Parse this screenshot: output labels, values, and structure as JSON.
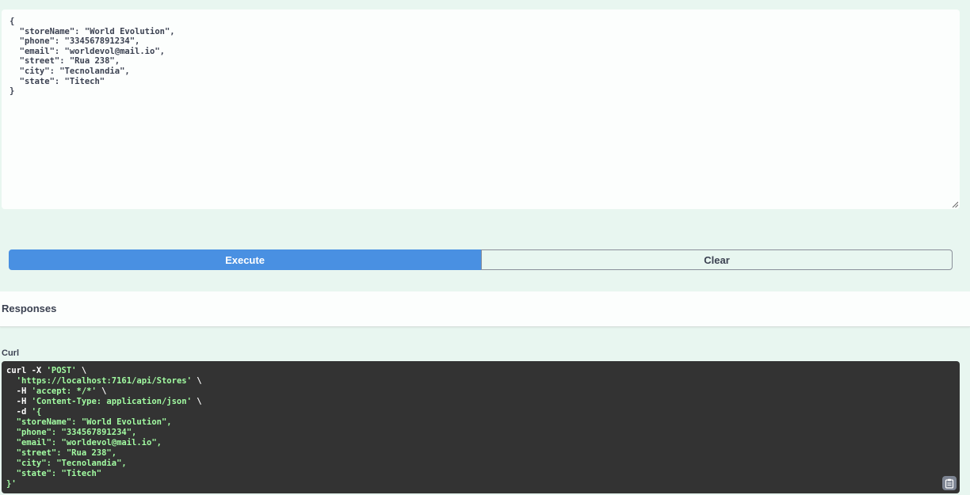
{
  "request_body": {
    "lines": [
      "{",
      "  \"storeName\": \"World Evolution\",",
      "  \"phone\": \"334567891234\",",
      "  \"email\": \"worldevol@mail.io\",",
      "  \"street\": \"Rua 238\",",
      "  \"city\": \"Tecnolandia\",",
      "  \"state\": \"Titech\"",
      "}"
    ]
  },
  "actions": {
    "execute_label": "Execute",
    "clear_label": "Clear"
  },
  "responses": {
    "title": "Responses",
    "curl_label": "Curl",
    "curl_lines": [
      [
        "curl -X ",
        "'POST'",
        " \\"
      ],
      [
        "  ",
        "'https://localhost:7161/api/Stores'",
        " \\"
      ],
      [
        "  -H ",
        "'accept: */*'",
        " \\"
      ],
      [
        "  -H ",
        "'Content-Type: application/json'",
        " \\"
      ],
      [
        "  -d ",
        "'{",
        ""
      ],
      [
        "",
        "  \"storeName\": \"World Evolution\",",
        ""
      ],
      [
        "",
        "  \"phone\": \"334567891234\",",
        ""
      ],
      [
        "",
        "  \"email\": \"worldevol@mail.io\",",
        ""
      ],
      [
        "",
        "  \"street\": \"Rua 238\",",
        ""
      ],
      [
        "",
        "  \"city\": \"Tecnolandia\",",
        ""
      ],
      [
        "",
        "  \"state\": \"Titech\"",
        ""
      ],
      [
        "",
        "}'",
        ""
      ]
    ]
  },
  "colors": {
    "accent": "#4990e2",
    "page_bg": "#e8f6f0",
    "code_bg": "#333333",
    "code_string": "#a2fca2"
  },
  "icons": {
    "copy": "clipboard-icon",
    "resize": "resize-handle-icon"
  }
}
